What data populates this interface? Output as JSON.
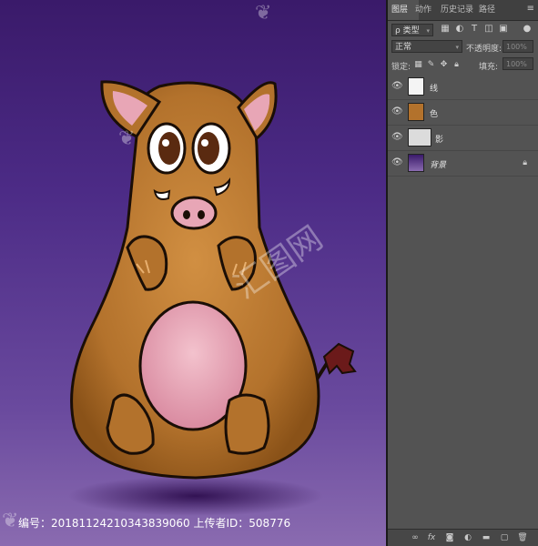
{
  "panel": {
    "tabs": [
      "图层",
      "动作",
      "历史记录",
      "路径"
    ],
    "menu_label": "≡",
    "filter": {
      "kind_label": "ρ 类型"
    },
    "blend_mode": "正常",
    "opacity_label": "不透明度:",
    "opacity_value": "100%",
    "lock_label": "锁定:",
    "fill_label": "填充:",
    "fill_value": "100%",
    "layers": [
      {
        "name": "线",
        "visible": true
      },
      {
        "name": "色",
        "visible": true
      },
      {
        "name": "影",
        "visible": true
      },
      {
        "name": "背景",
        "visible": true,
        "locked": true
      }
    ]
  },
  "footer": {
    "id_text": "编号：20181124210343839060 上传者ID：508776"
  },
  "colors": {
    "body": "#b8752d",
    "belly": "#e8a6b6",
    "background_top": "#3a1a6a",
    "background_bottom": "#8a6bb0",
    "panel": "#535353"
  }
}
